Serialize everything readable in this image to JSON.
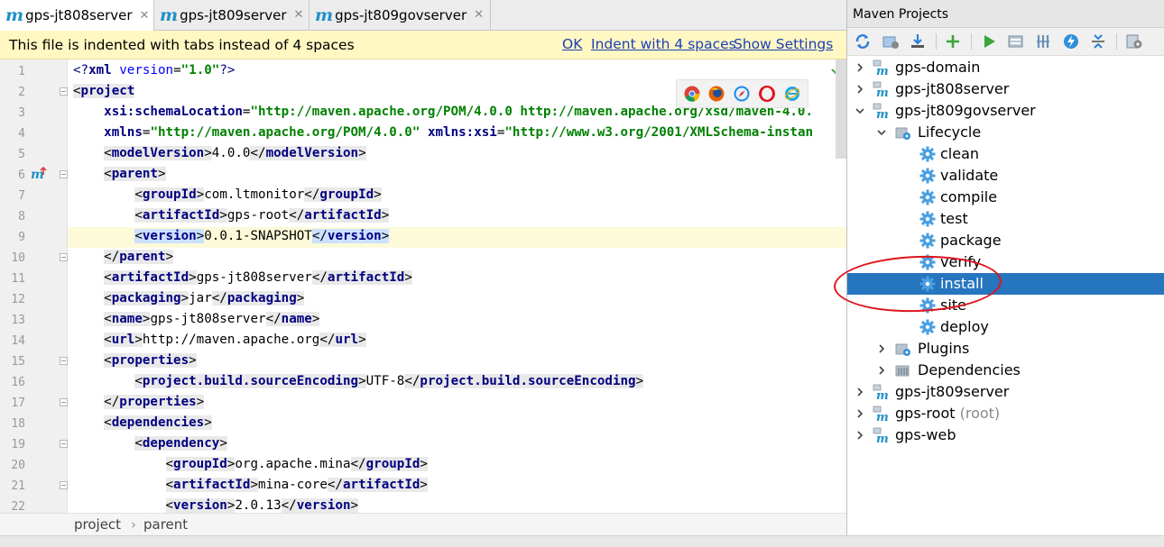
{
  "tabs": [
    {
      "icon": "m",
      "label": "gps-jt808server",
      "close": "✕",
      "active": true
    },
    {
      "icon": "m",
      "label": "gps-jt809server",
      "close": "✕",
      "active": false
    },
    {
      "icon": "m",
      "label": "gps-jt809govserver",
      "close": "✕",
      "active": false
    }
  ],
  "notification": {
    "message": "This file is indented with tabs instead of 4 spaces",
    "ok": "OK",
    "indent": "Indent with 4 spaces",
    "show_settings": "Show Settings"
  },
  "gutter": {
    "line_numbers": [
      "1",
      "2",
      "3",
      "4",
      "5",
      "6",
      "7",
      "8",
      "9",
      "10",
      "11",
      "12",
      "13",
      "14",
      "15",
      "16",
      "17",
      "18",
      "19",
      "20",
      "21",
      "22"
    ]
  },
  "code": {
    "l1": {
      "a": "<?",
      "b": "xml ",
      "c": "version",
      "d": "=",
      "e": "\"1.0\"",
      "f": "?>"
    },
    "l2": {
      "tag": "project"
    },
    "l3": {
      "name": "xsi:schemaLocation",
      "val": "\"http://maven.apache.org/POM/4.0.0 http://maven.apache.org/xsd/maven-4.0."
    },
    "l4": {
      "name1": "xmlns",
      "val1": "\"http://maven.apache.org/POM/4.0.0\"",
      "name2": "xmlns:xsi",
      "val2": "\"http://www.w3.org/2001/XMLSchema-instan"
    },
    "l5": {
      "tag": "modelVersion",
      "text": "4.0.0"
    },
    "l6": {
      "tag": "parent"
    },
    "l7": {
      "tag": "groupId",
      "text": "com.ltmonitor"
    },
    "l8": {
      "tag": "artifactId",
      "text": "gps-root"
    },
    "l9": {
      "tag": "version",
      "text": "0.0.1-SNAPSHOT"
    },
    "l10": {
      "tag": "parent"
    },
    "l11": {
      "tag": "artifactId",
      "text": "gps-jt808server"
    },
    "l12": {
      "tag": "packaging",
      "text": "jar"
    },
    "l13": {
      "tag": "name",
      "text": "gps-jt808server"
    },
    "l14": {
      "tag": "url",
      "text": "http://maven.apache.org"
    },
    "l15": {
      "tag": "properties"
    },
    "l16": {
      "tag": "project.build.sourceEncoding",
      "text": "UTF-8"
    },
    "l17": {
      "tag": "properties"
    },
    "l18": {
      "tag": "dependencies"
    },
    "l19": {
      "tag": "dependency"
    },
    "l20": {
      "tag": "groupId",
      "text": "org.apache.mina"
    },
    "l21": {
      "tag": "artifactId",
      "text": "mina-core"
    },
    "l22": {
      "tag": "version",
      "text": "2.0.13"
    }
  },
  "breadcrumb": {
    "item1": "project",
    "sep": "›",
    "item2": "parent"
  },
  "maven": {
    "title": "Maven Projects",
    "tree": [
      {
        "label": "gps-domain"
      },
      {
        "label": "gps-jt808server"
      },
      {
        "label": "gps-jt809govserver"
      },
      {
        "label": "Lifecycle"
      },
      {
        "label": "clean"
      },
      {
        "label": "validate"
      },
      {
        "label": "compile"
      },
      {
        "label": "test"
      },
      {
        "label": "package"
      },
      {
        "label": "verify"
      },
      {
        "label": "install",
        "selected": true
      },
      {
        "label": "site"
      },
      {
        "label": "deploy"
      },
      {
        "label": "Plugins"
      },
      {
        "label": "Dependencies"
      },
      {
        "label": "gps-jt809server"
      },
      {
        "label": "gps-root",
        "suffix": "(root)"
      },
      {
        "label": "gps-web"
      }
    ]
  },
  "colors": {
    "accent": "#2675bf",
    "annotation": "#e0141e",
    "notification_bg": "#fff8c3",
    "link": "#1d3fb8"
  }
}
